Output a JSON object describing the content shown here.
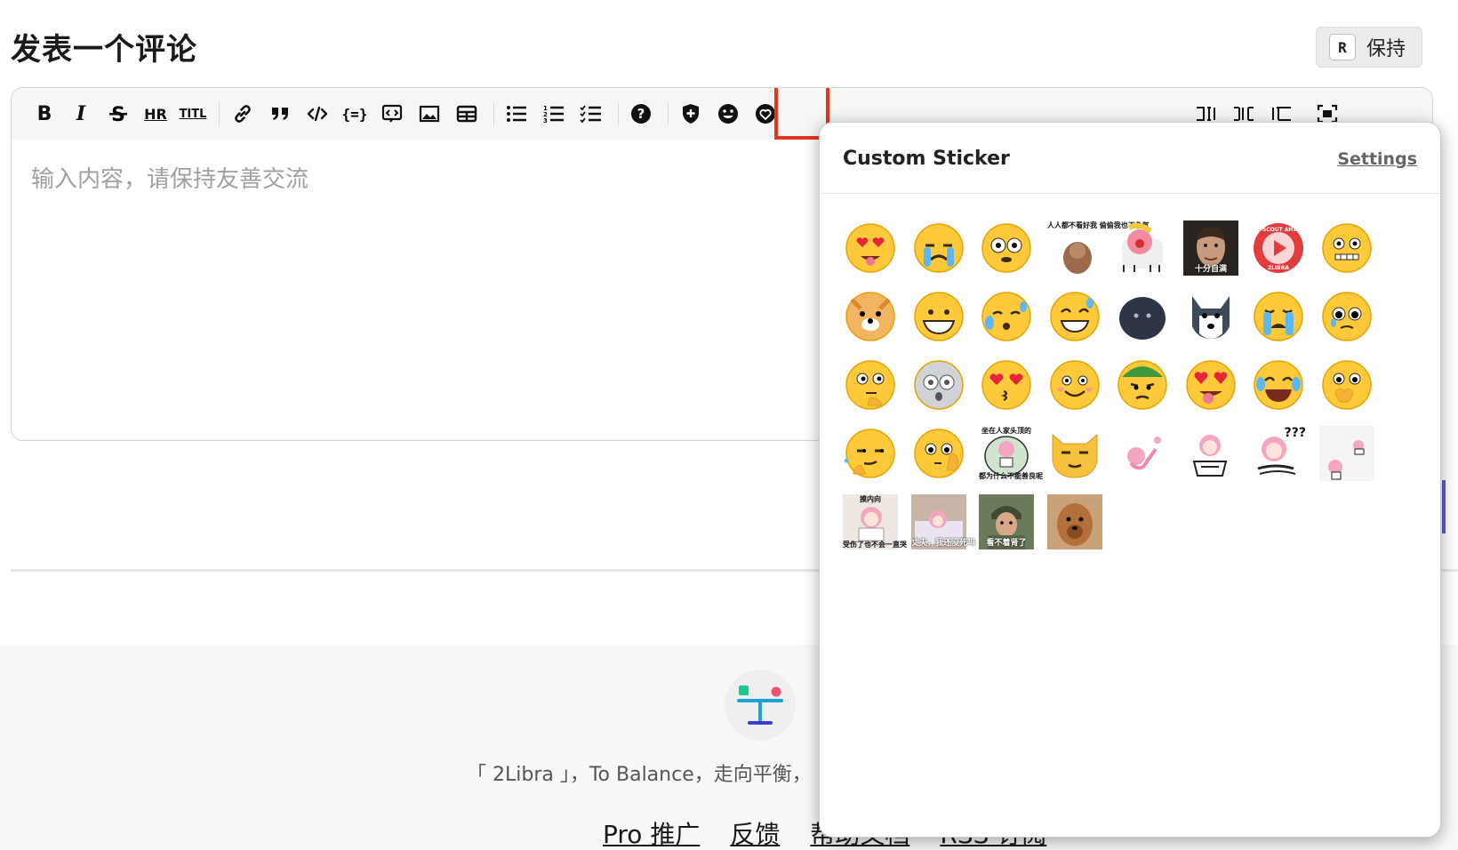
{
  "header": {
    "title": "发表一个评论",
    "keep_key": "R",
    "keep_label": "保持"
  },
  "editor": {
    "placeholder": "输入内容，请保持友善交流",
    "toolbar": {
      "bold": "B",
      "italic": "I",
      "hr": "HR",
      "title": "TITL"
    }
  },
  "sticker_panel": {
    "title": "Custom Sticker",
    "settings_label": "Settings",
    "stickers": [
      {
        "name": "heart-eyes-tongue"
      },
      {
        "name": "crying"
      },
      {
        "name": "shocked-eyes"
      },
      {
        "name": "meme-text",
        "top_caption": "人人都不看好我\n偷偷我也不争气"
      },
      {
        "name": "clown-cat"
      },
      {
        "name": "face-photo",
        "caption": "十分自满"
      },
      {
        "name": "scout-badge"
      },
      {
        "name": "nervous-smile"
      },
      {
        "name": "shiba"
      },
      {
        "name": "grin"
      },
      {
        "name": "sweat"
      },
      {
        "name": "grin-sweat"
      },
      {
        "name": "dark-ball"
      },
      {
        "name": "husky"
      },
      {
        "name": "sob"
      },
      {
        "name": "pleading"
      },
      {
        "name": "thinking"
      },
      {
        "name": "dizzy-gray"
      },
      {
        "name": "heart-kiss"
      },
      {
        "name": "smile-blush"
      },
      {
        "name": "green-hat"
      },
      {
        "name": "heart-tongue"
      },
      {
        "name": "laugh-cry"
      },
      {
        "name": "shy-cover"
      },
      {
        "name": "smirk-sparkle"
      },
      {
        "name": "thinking-hand"
      },
      {
        "name": "anime-meme",
        "top_caption": "坐在人家头顶的",
        "bottom_caption": "都为什么不能善良呢"
      },
      {
        "name": "cat-smug"
      },
      {
        "name": "anime-dance"
      },
      {
        "name": "anime-read"
      },
      {
        "name": "anime-question",
        "qmark": "???"
      },
      {
        "name": "anime-peek"
      },
      {
        "name": "anime-sit",
        "top_caption": "摸内向",
        "bottom_caption": "受伤了也不会一直哭"
      },
      {
        "name": "anime-bed",
        "caption": "丈夫，我还没死吗"
      },
      {
        "name": "soldier",
        "caption": "看不着肾了"
      },
      {
        "name": "dog-photo"
      }
    ]
  },
  "footer": {
    "tagline": "「 2Libra 」，To Balance，走向平衡，",
    "links": [
      "Pro 推广",
      "反馈",
      "帮助文档",
      "RSS 订阅"
    ]
  }
}
